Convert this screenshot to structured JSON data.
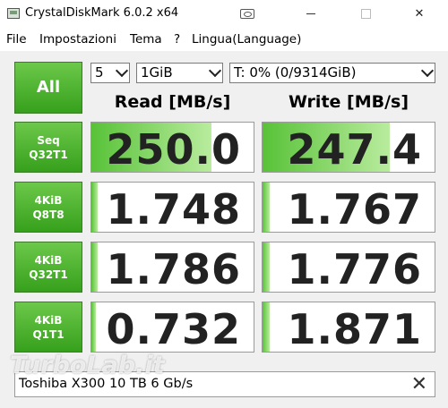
{
  "window": {
    "title": "CrystalDiskMark 6.0.2 x64",
    "close_glyph": "✕"
  },
  "menu": [
    "File",
    "Impostazioni",
    "Tema",
    "?",
    "Lingua(Language)"
  ],
  "controls": {
    "all_label": "All",
    "count_value": "5",
    "size_value": "1GiB",
    "drive_value": "T: 0% (0/9314GiB)"
  },
  "headers": {
    "read": "Read [MB/s]",
    "write": "Write [MB/s]"
  },
  "rows": [
    {
      "line1": "Seq",
      "line2": "Q32T1",
      "read": "250.0",
      "write": "247.4",
      "read_fill": 0.74,
      "write_fill": 0.74
    },
    {
      "line1": "4KiB",
      "line2": "Q8T8",
      "read": "1.748",
      "write": "1.767",
      "read_fill": 0.04,
      "write_fill": 0.04
    },
    {
      "line1": "4KiB",
      "line2": "Q32T1",
      "read": "1.786",
      "write": "1.776",
      "read_fill": 0.04,
      "write_fill": 0.04
    },
    {
      "line1": "4KiB",
      "line2": "Q1T1",
      "read": "0.732",
      "write": "1.871",
      "read_fill": 0.03,
      "write_fill": 0.04
    }
  ],
  "comment": {
    "value": "Toshiba X300 10 TB 6 Gb/s",
    "clear_glyph": "✕"
  },
  "watermark": "TurboLab.it",
  "colors": {
    "green_button": "#36a01c",
    "bar_green": "#58c238"
  }
}
